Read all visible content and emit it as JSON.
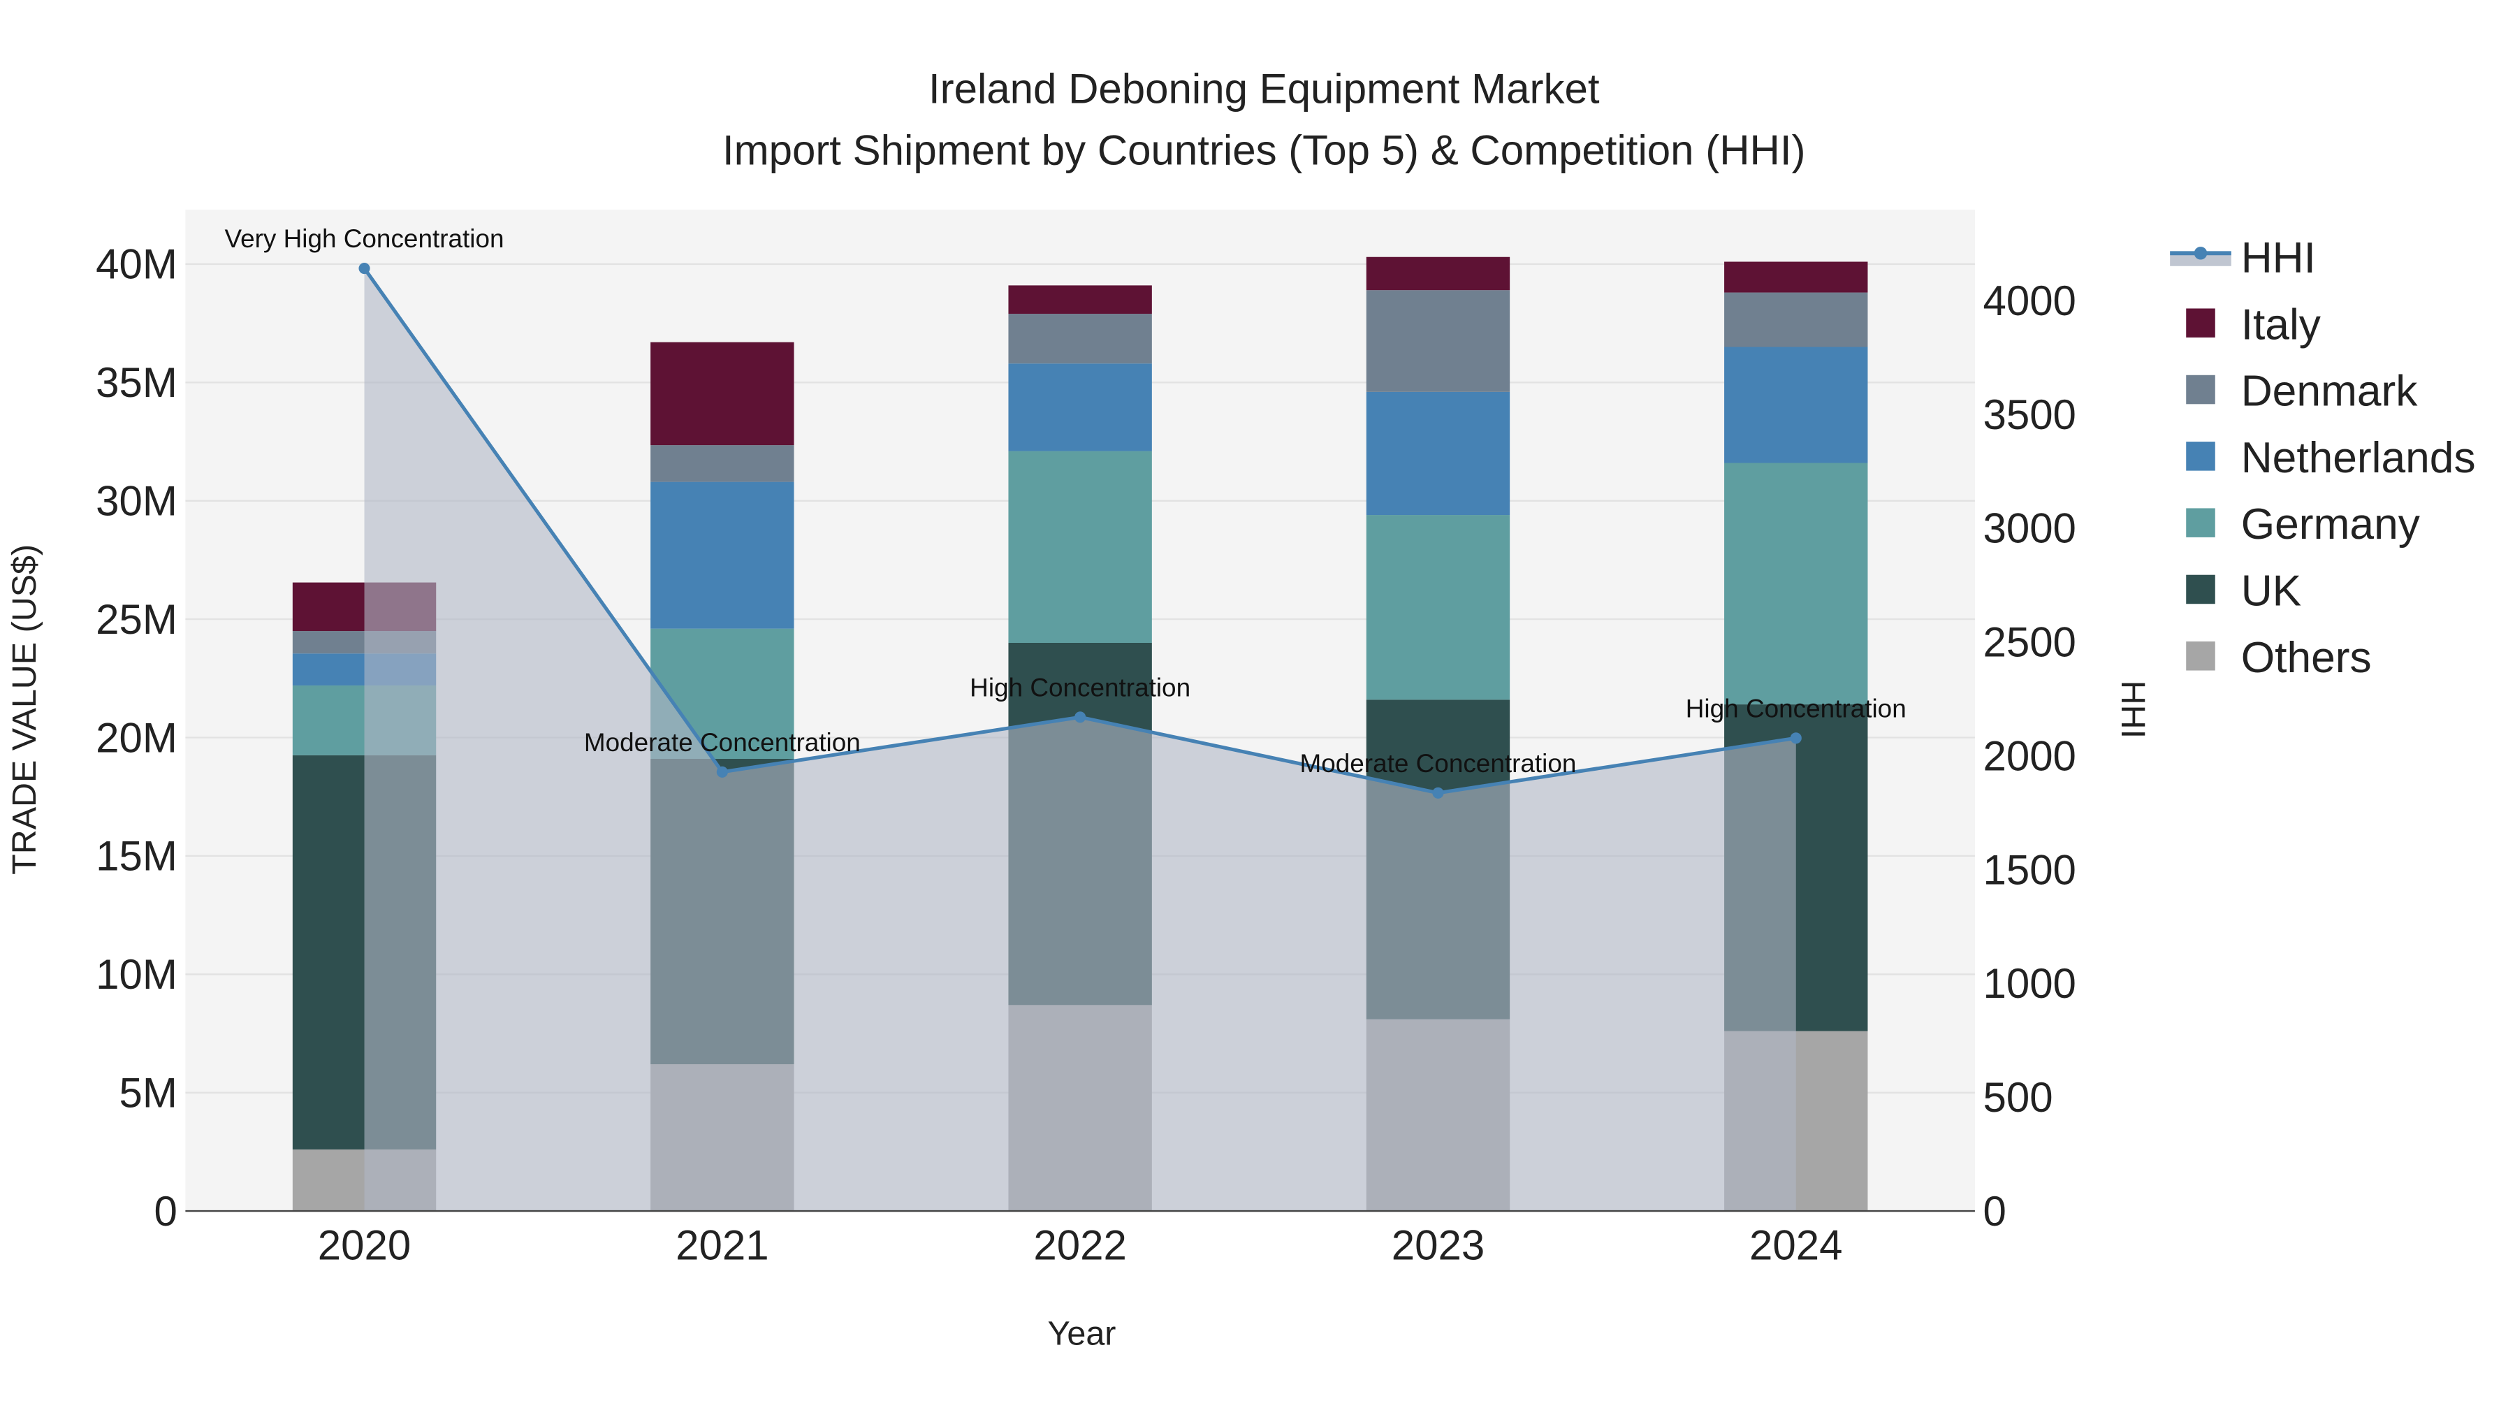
{
  "chart_data": {
    "type": "bar",
    "title": "Ireland Deboning Equipment Market",
    "subtitle": "Import Shipment by Countries (Top 5) & Competition (HHI)",
    "xlabel": "Year",
    "ylabel": "TRADE VALUE (US$)",
    "y2label": "HHI",
    "categories": [
      "2020",
      "2021",
      "2022",
      "2023",
      "2024"
    ],
    "ylim": [
      0,
      42300000
    ],
    "y2lim": [
      0,
      4400
    ],
    "yticks": [
      {
        "v": 0,
        "label": "0"
      },
      {
        "v": 5000000,
        "label": "5M"
      },
      {
        "v": 10000000,
        "label": "10M"
      },
      {
        "v": 15000000,
        "label": "15M"
      },
      {
        "v": 20000000,
        "label": "20M"
      },
      {
        "v": 25000000,
        "label": "25M"
      },
      {
        "v": 30000000,
        "label": "30M"
      },
      {
        "v": 35000000,
        "label": "35M"
      },
      {
        "v": 40000000,
        "label": "40M"
      }
    ],
    "y2ticks": [
      0,
      500,
      1000,
      1500,
      2000,
      2500,
      3000,
      3500,
      4000
    ],
    "series": [
      {
        "name": "Others",
        "color": "#a6a6a6",
        "values": [
          2600000,
          6200000,
          8700000,
          8100000,
          7600000
        ]
      },
      {
        "name": "UK",
        "color": "#2f4f4f",
        "values": [
          16650000,
          12900000,
          15300000,
          13500000,
          13800000
        ]
      },
      {
        "name": "Germany",
        "color": "#5f9ea0",
        "values": [
          2950000,
          5500000,
          8100000,
          7800000,
          10200000
        ]
      },
      {
        "name": "Netherlands",
        "color": "#4682b4",
        "values": [
          1350000,
          6200000,
          3700000,
          5200000,
          4900000
        ]
      },
      {
        "name": "Denmark",
        "color": "#708090",
        "values": [
          950000,
          1550000,
          2100000,
          4300000,
          2300000
        ]
      },
      {
        "name": "Italy",
        "color": "#5e1234",
        "values": [
          2050000,
          4350000,
          1200000,
          1400000,
          1300000
        ]
      }
    ],
    "hhi": {
      "name": "HHI",
      "color": "#4682b4",
      "values": [
        4142,
        1929,
        2170,
        1837,
        2078
      ],
      "annotations": [
        "Very High Concentration",
        "Moderate Concentration",
        "High Concentration",
        "Moderate Concentration",
        "High Concentration"
      ]
    },
    "legend": [
      "HHI",
      "Italy",
      "Denmark",
      "Netherlands",
      "Germany",
      "UK",
      "Others"
    ],
    "legend_position": "right"
  }
}
